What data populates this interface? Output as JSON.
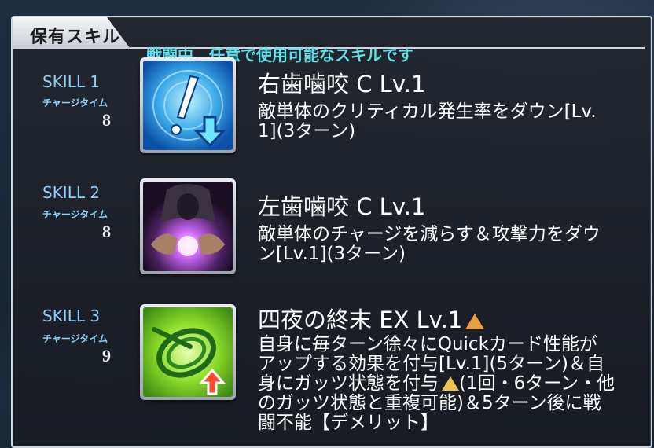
{
  "header": {
    "title": "保有スキル",
    "subtitle": "戦闘中、任意で使用可能なスキルです"
  },
  "skills": [
    {
      "slot_label": "SKILL 1",
      "charge_label": "チャージタイム",
      "charge_value": "8",
      "name": "右歯噛咬 C Lv.1",
      "desc_lines": [
        "敵単体のクリティカル発生率をダウン[Lv.",
        "1](3ターン)"
      ],
      "icon": "crit-down-icon"
    },
    {
      "slot_label": "SKILL 2",
      "charge_label": "チャージタイム",
      "charge_value": "8",
      "name": "左歯噛咬 C Lv.1",
      "desc_lines": [
        "敵単体のチャージを減らす＆攻撃力をダウ",
        "ン[Lv.1](3ターン)"
      ],
      "icon": "charge-drain-icon"
    },
    {
      "slot_label": "SKILL 3",
      "charge_label": "チャージタイム",
      "charge_value": "9",
      "name": "四夜の終末 EX Lv.1",
      "desc_lines": [
        "自身に毎ターン徐々にQuickカード性能が",
        "アップする効果を付与[Lv.1](5ターン)＆自",
        "身にガッツ状態を付与",
        "(1回・6ターン・他",
        "のガッツ状態と重複可能)＆5ターン後に戦",
        "闘不能【デメリット】"
      ],
      "icon": "quick-up-icon",
      "upgrade_icon": "upgrade-triangle-icon"
    }
  ],
  "colors": {
    "accent_cyan": "#5fe0e8",
    "label_blue": "#8fd0f8",
    "upgrade_orange": "#e9a040"
  }
}
